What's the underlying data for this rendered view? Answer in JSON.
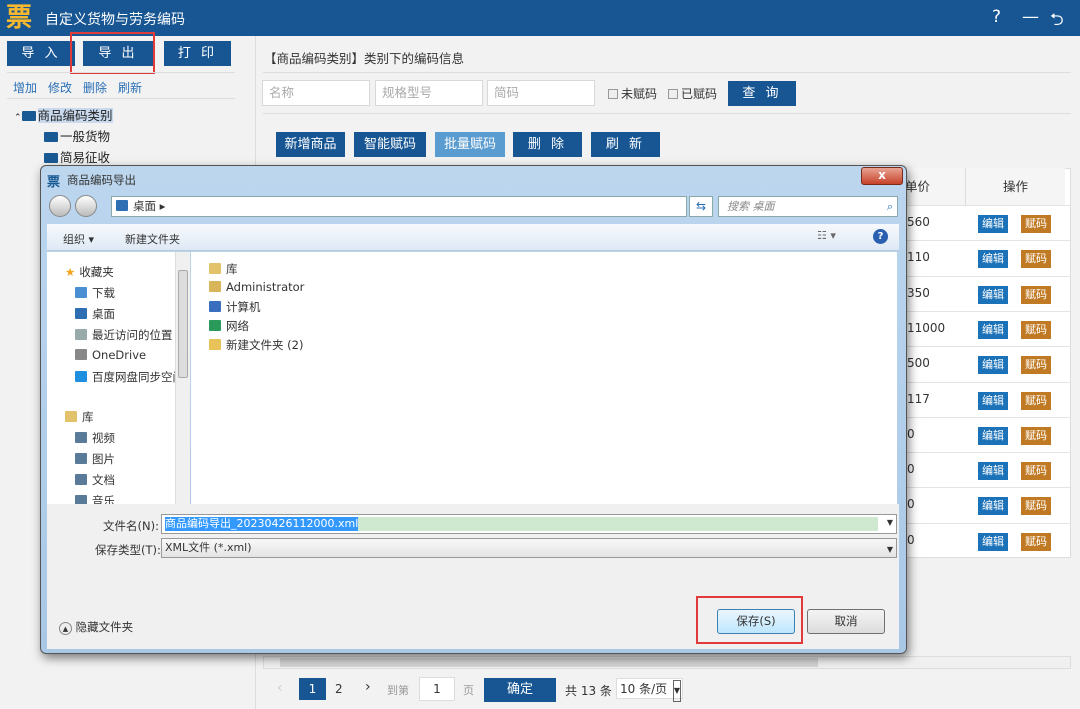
{
  "app": {
    "title": "自定义货物与劳务编码",
    "logo": "票",
    "help": "?",
    "minimize": "—",
    "back": "⮌"
  },
  "left": {
    "buttons": [
      "导 入",
      "导 出",
      "打 印"
    ],
    "links": [
      "增加",
      "修改",
      "删除",
      "刷新"
    ],
    "tree": {
      "root": "商品编码类别",
      "children": [
        "一般货物",
        "简易征收"
      ]
    }
  },
  "main": {
    "heading": "【商品编码类别】类别下的编码信息",
    "search": {
      "name_placeholder": "名称",
      "spec_placeholder": "规格型号",
      "short_placeholder": "简码",
      "unassigned": "未赋码",
      "assigned": "已赋码",
      "query": "查 询"
    },
    "actions": [
      "新增商品",
      "智能赋码",
      "批量赋码",
      "删 除",
      "刷 新"
    ],
    "table": {
      "col_price": "单价",
      "col_ops": "操作",
      "edit": "编辑",
      "assign": "赋码",
      "prices": [
        "560",
        "110",
        "350",
        "11000",
        "500",
        "117",
        "0",
        "0",
        "0",
        "0"
      ]
    },
    "pager": {
      "pages": [
        "1",
        "2"
      ],
      "goto": "到第",
      "goto_value": "1",
      "page_unit": "页",
      "confirm": "确定",
      "total": "共 13 条",
      "per_page": "10 条/页"
    }
  },
  "dialog": {
    "title": "商品编码导出",
    "close": "x",
    "path": "桌面",
    "search_placeholder": "搜索 桌面",
    "organize": "组织 ▾",
    "new_folder": "新建文件夹",
    "nav": {
      "favorites": "收藏夹",
      "fav_items": [
        "下载",
        "桌面",
        "最近访问的位置",
        "OneDrive",
        "百度网盘同步空间"
      ],
      "library": "库",
      "lib_items": [
        "视频",
        "图片",
        "文档",
        "音乐"
      ]
    },
    "files": [
      "库",
      "Administrator",
      "计算机",
      "网络",
      "新建文件夹 (2)"
    ],
    "filename_label": "文件名(N):",
    "filename": "商品编码导出_20230426112000.xml",
    "type_label": "保存类型(T):",
    "type": "XML文件 (*.xml)",
    "hide_folders": "隐藏文件夹",
    "save": "保存(S)",
    "cancel": "取消"
  }
}
